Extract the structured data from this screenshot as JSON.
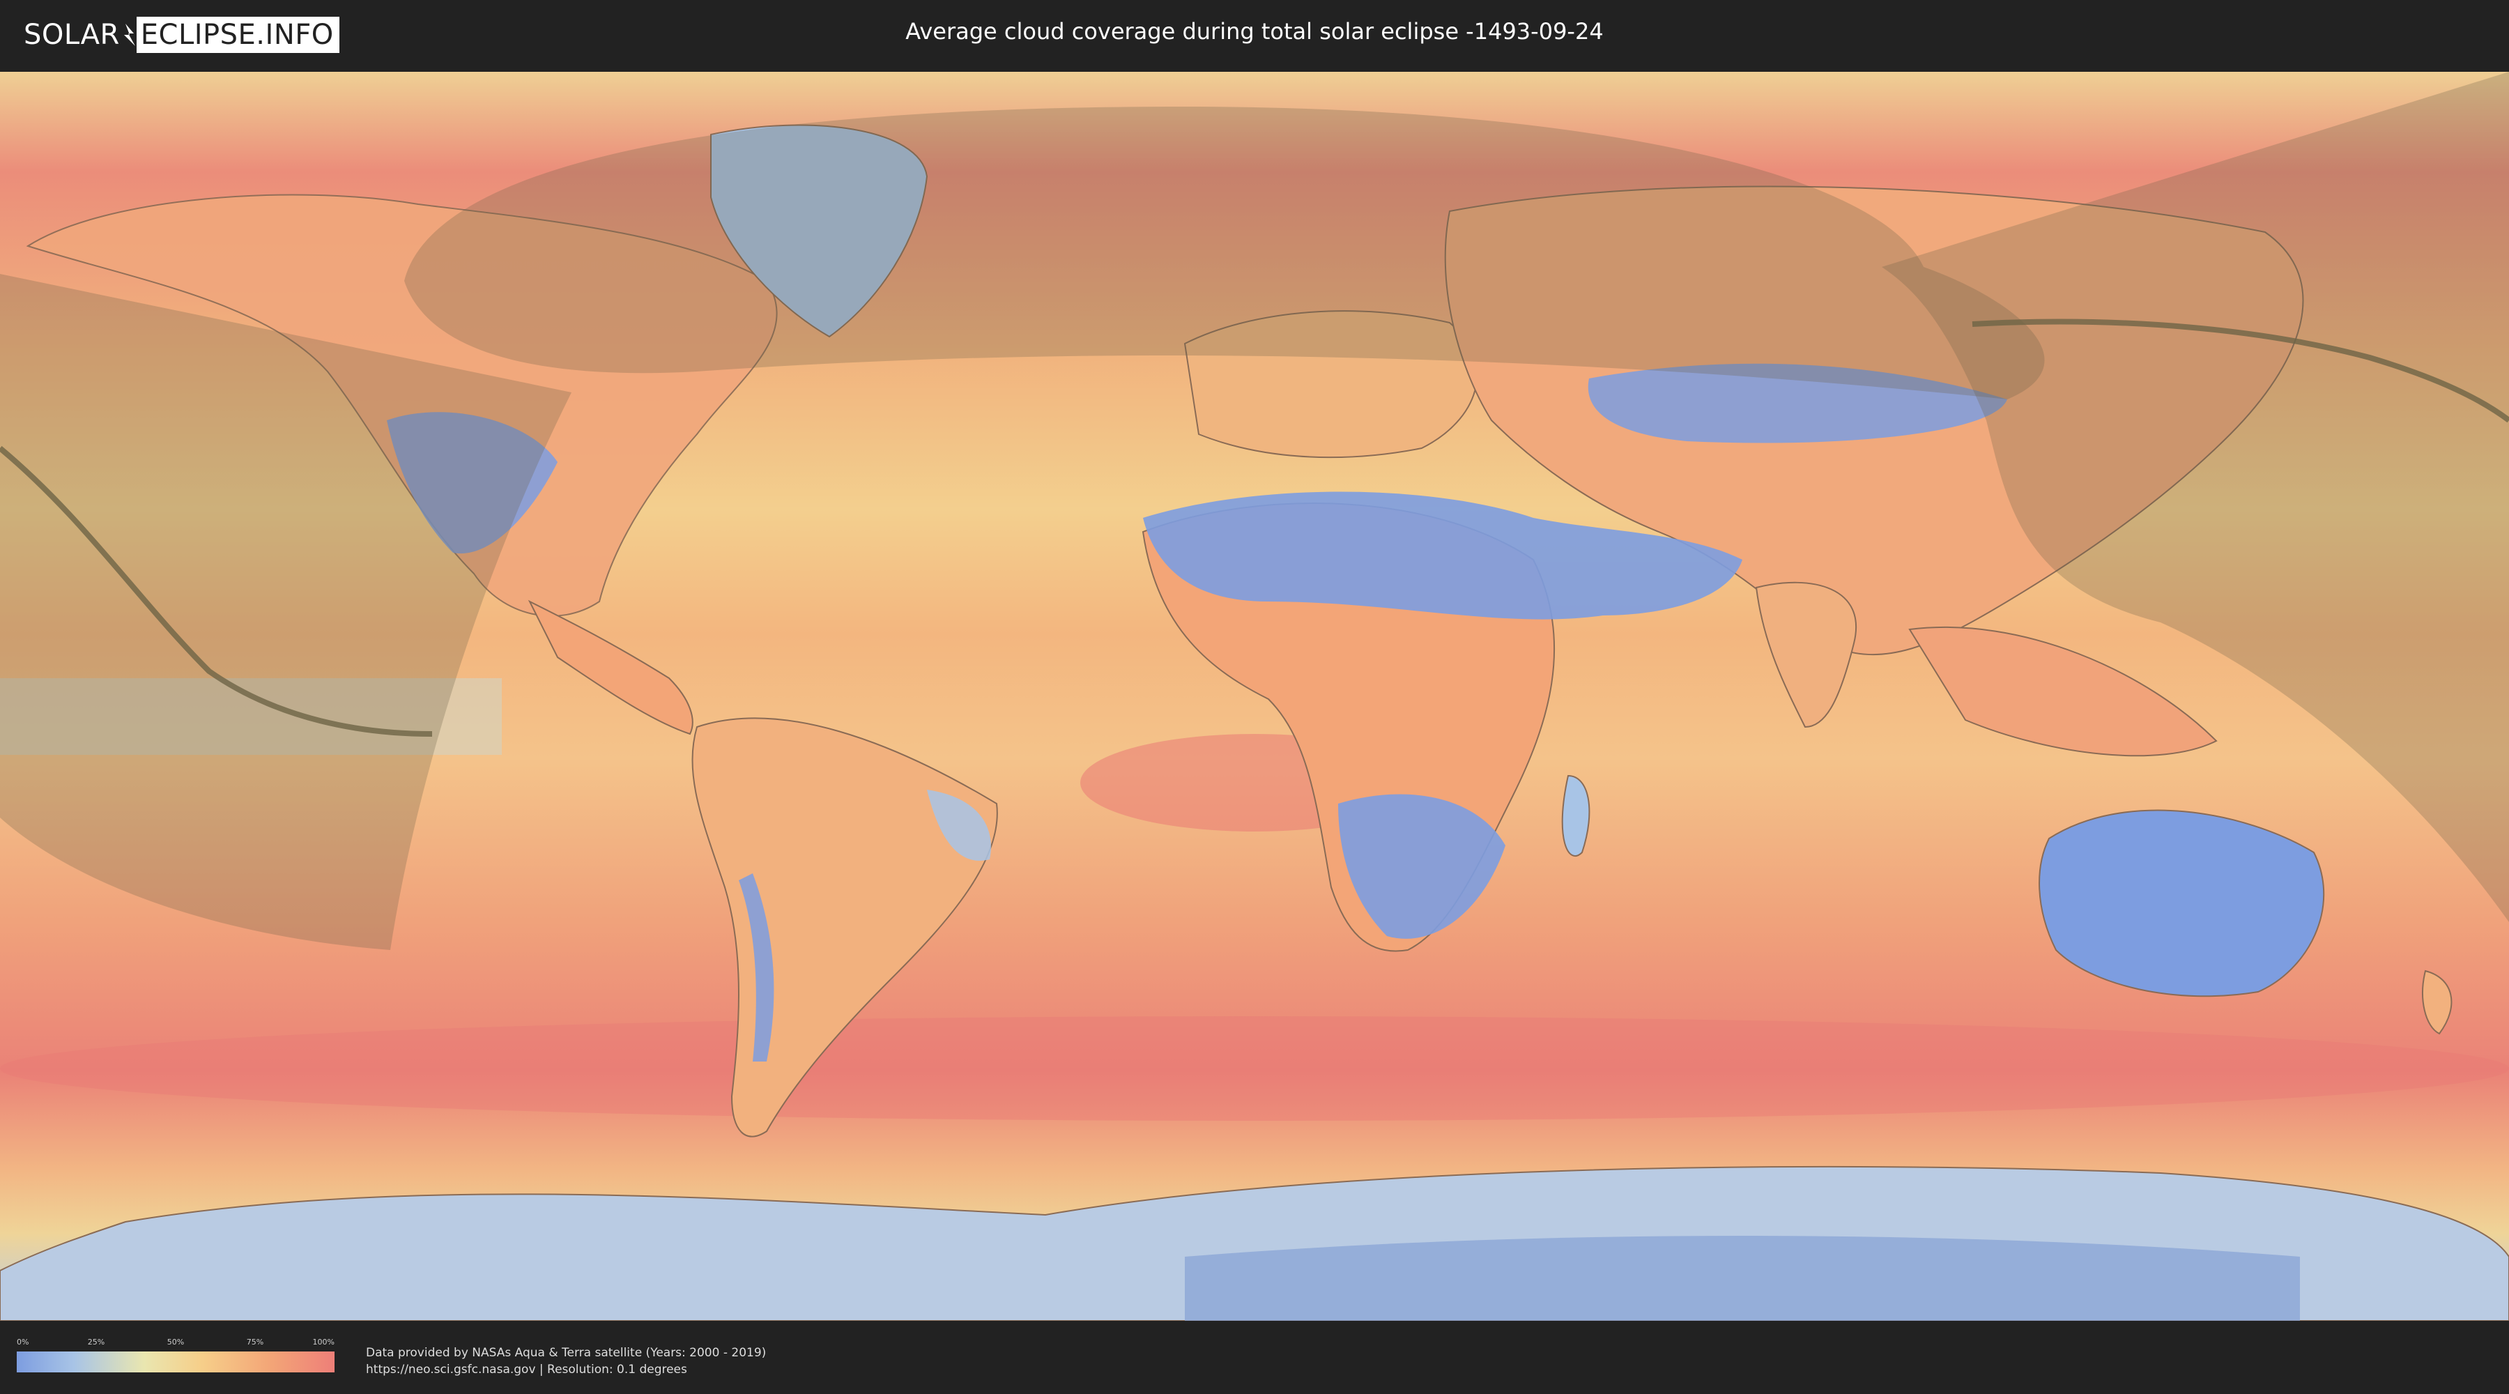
{
  "header": {
    "logo_part1": "SOLAR",
    "logo_part2": "ECLIPSE.INFO",
    "title": "Average cloud coverage during total solar eclipse -1493-09-24"
  },
  "legend": {
    "ticks": [
      "0%",
      "25%",
      "50%",
      "75%",
      "100%"
    ],
    "colors": [
      "#7d9de0",
      "#a8c4e6",
      "#e9e6b0",
      "#f6cf8a",
      "#f3a577",
      "#ee7f78"
    ]
  },
  "footer": {
    "credit_line1": "Data provided by NASAs Aqua & Terra satellite (Years: 2000 - 2019)",
    "credit_line2": "https://neo.sci.gsfc.nasa.gov | Resolution: 0.1 degrees"
  },
  "map": {
    "colors": {
      "clear": "#7d9de0",
      "low": "#a8c4e6",
      "mid": "#f0dc9c",
      "high": "#f3a577",
      "overcast": "#e97a75",
      "shadow_overlay": "#6b6147",
      "central_line": "#6e6446"
    }
  }
}
